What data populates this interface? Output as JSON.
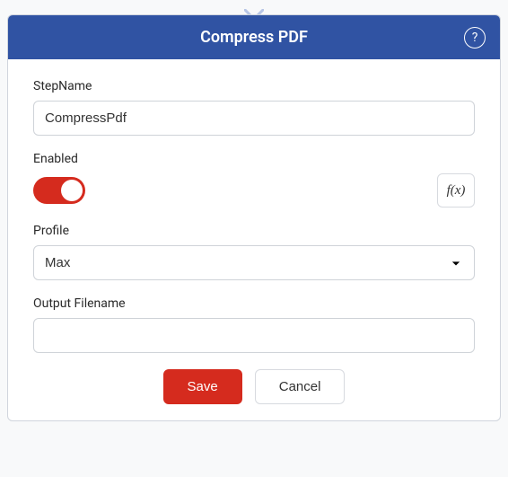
{
  "header": {
    "title": "Compress PDF"
  },
  "fields": {
    "stepName": {
      "label": "StepName",
      "value": "CompressPdf"
    },
    "enabled": {
      "label": "Enabled",
      "value": true
    },
    "fx": {
      "label": "f(x)"
    },
    "profile": {
      "label": "Profile",
      "selected": "Max"
    },
    "outputFilename": {
      "label": "Output Filename",
      "value": ""
    }
  },
  "actions": {
    "save": "Save",
    "cancel": "Cancel"
  }
}
